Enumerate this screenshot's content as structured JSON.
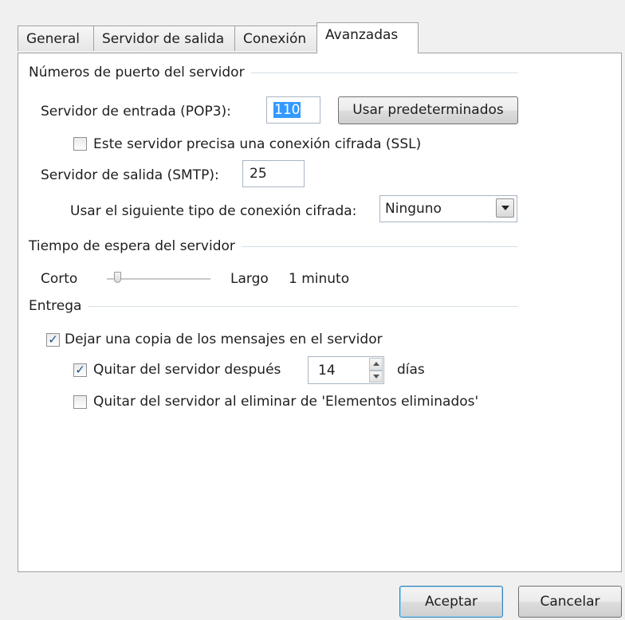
{
  "tabs": [
    {
      "label": "General"
    },
    {
      "label": "Servidor de salida"
    },
    {
      "label": "Conexión"
    },
    {
      "label": "Avanzadas"
    }
  ],
  "ports": {
    "group_title": "Números de puerto del servidor",
    "incoming_label": "Servidor de entrada (POP3):",
    "incoming_value": "110",
    "defaults_button": "Usar predeterminados",
    "ssl_label": "Este servidor precisa una conexión cifrada (SSL)",
    "ssl_checked": false,
    "outgoing_label": "Servidor de salida (SMTP):",
    "outgoing_value": "25",
    "encryption_label": "Usar el siguiente tipo de conexión cifrada:",
    "encryption_value": "Ninguno"
  },
  "timeout": {
    "group_title": "Tiempo de espera del servidor",
    "short_label": "Corto",
    "long_label": "Largo",
    "value_label": "1 minuto"
  },
  "delivery": {
    "group_title": "Entrega",
    "leave_copy_label": "Dejar una copia de los mensajes en el servidor",
    "leave_copy_checked": true,
    "remove_after_label": "Quitar del servidor después",
    "remove_after_checked": true,
    "days_value": "14",
    "days_label": "días",
    "remove_deleted_label": "Quitar del servidor al eliminar de 'Elementos eliminados'",
    "remove_deleted_checked": false
  },
  "footer": {
    "ok_label": "Aceptar",
    "cancel_label": "Cancelar"
  },
  "icons": {
    "check": "✓",
    "dropdown": "chevron-down-icon",
    "spin_up": "arrow-up-icon",
    "spin_down": "arrow-down-icon"
  },
  "colors": {
    "selection": "#3399ff",
    "default_button_border": "#3c7fb1",
    "check_mark": "#1f4e8c"
  }
}
